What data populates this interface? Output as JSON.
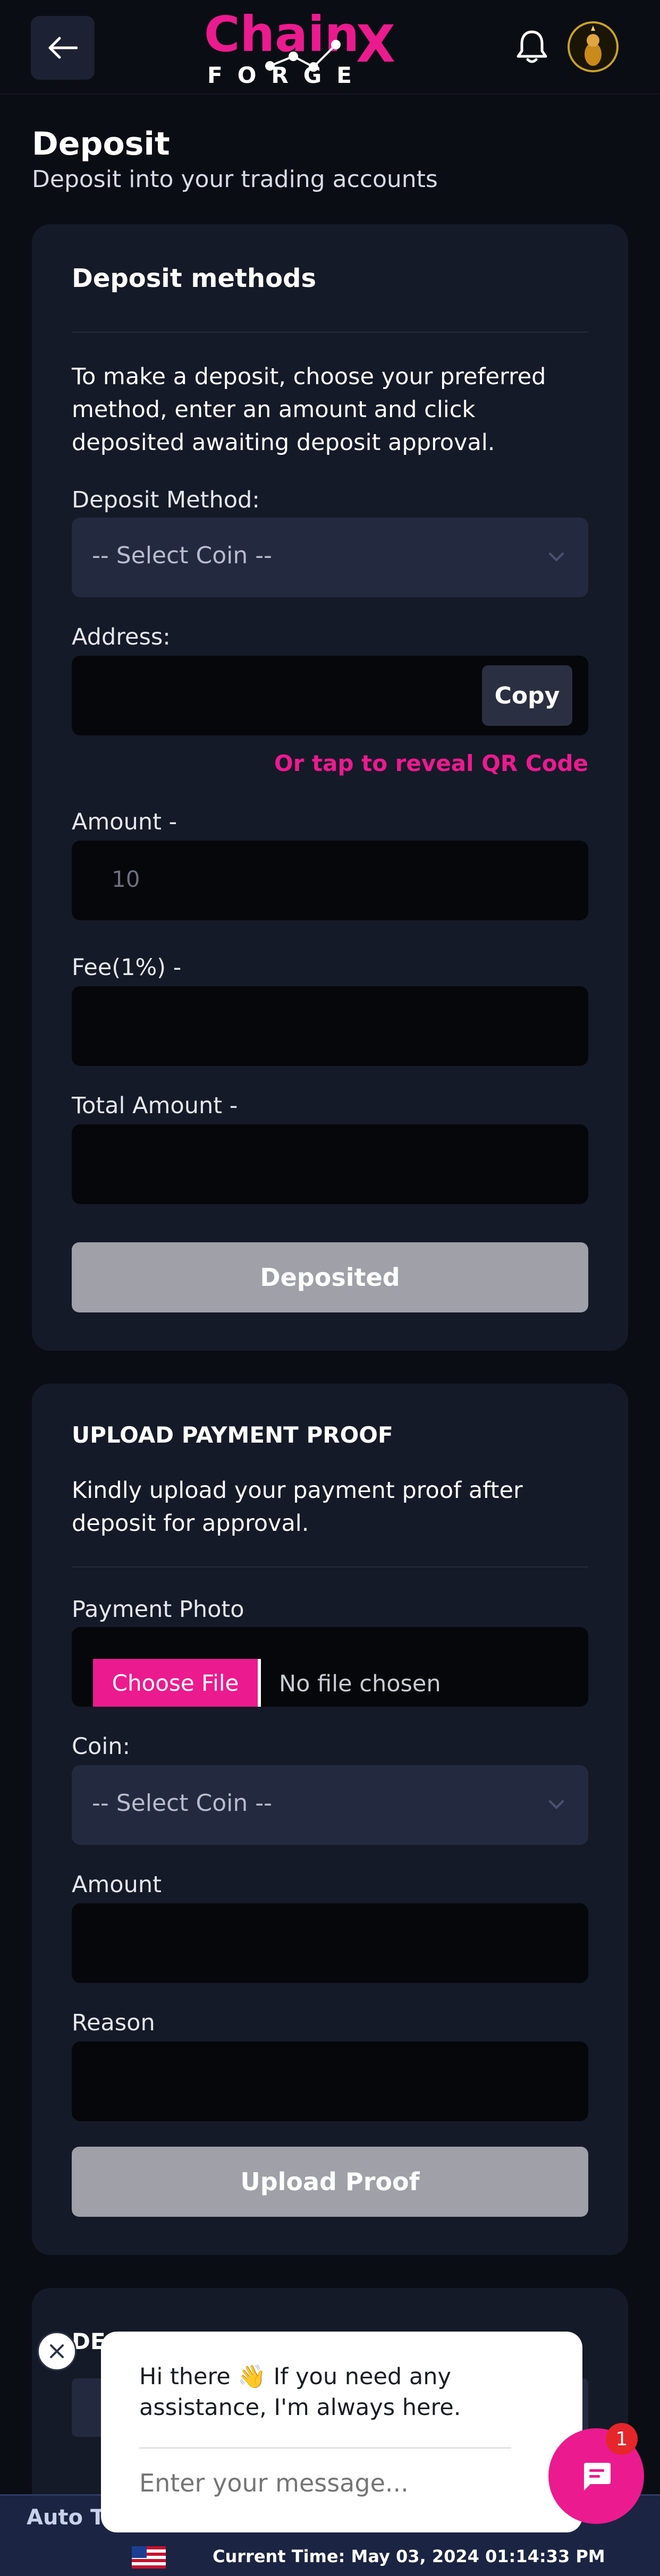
{
  "header": {
    "brand_top": "Chain",
    "brand_x": "X",
    "brand_bottom": "FORGE"
  },
  "page": {
    "title": "Deposit",
    "subtitle": "Deposit into your trading accounts"
  },
  "deposit_card": {
    "title": "Deposit methods",
    "instructions": "To make a deposit, choose your preferred method, enter an amount and click deposited awaiting deposit approval.",
    "method_label": "Deposit Method:",
    "method_value": "-- Select Coin --",
    "address_label": "Address:",
    "copy_label": "Copy",
    "qr_link": "Or tap to reveal QR Code",
    "amount_label": "Amount -",
    "amount_value": "10",
    "fee_label": "Fee(1%) -",
    "total_label": "Total Amount -",
    "submit_label": "Deposited"
  },
  "proof_card": {
    "title": "UPLOAD PAYMENT PROOF",
    "instructions": "Kindly upload your payment proof after deposit for approval.",
    "photo_label": "Payment Photo",
    "choose_file": "Choose File",
    "no_file": "No file chosen",
    "coin_label": "Coin:",
    "coin_value": "-- Select Coin --",
    "amount_label": "Amount",
    "reason_label": "Reason",
    "submit_label": "Upload Proof"
  },
  "deposits_card": {
    "title_visible": "DE"
  },
  "chat": {
    "greeting": "Hi there 👋 If you need any assistance, I'm always here.",
    "input_placeholder": "Enter your message...",
    "badge_count": "1"
  },
  "footer": {
    "auto_trade": "Auto Tr",
    "current_time": "Current Time: May 03, 2024 01:14:33 PM"
  },
  "colors": {
    "accent": "#ec1a8f",
    "background": "#0b0d14",
    "card": "#151a28"
  }
}
